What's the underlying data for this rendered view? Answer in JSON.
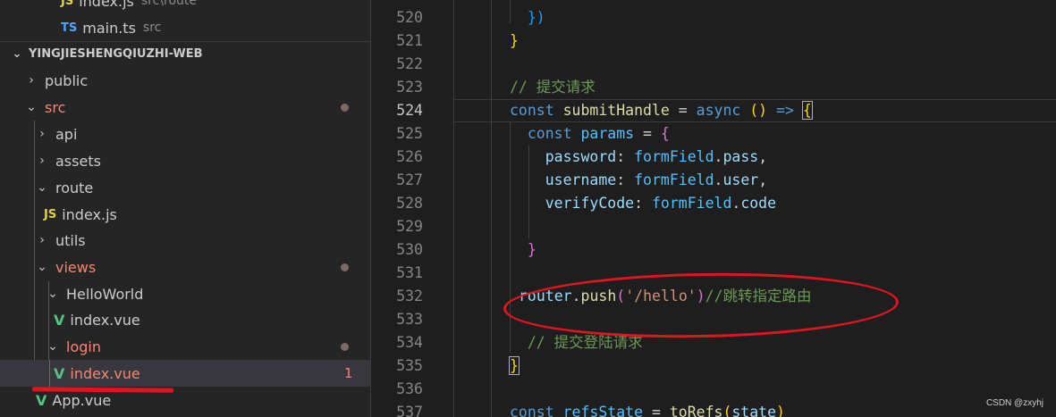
{
  "explorer": {
    "top_partial": {
      "label": "index.js",
      "suffix": "src\\route"
    },
    "open_file": {
      "label": "main.ts",
      "suffix": "src",
      "icon": "TS"
    },
    "project_name": "YINGJIESHENGQIUZHI-WEB",
    "items": [
      {
        "label": "public",
        "chev": "›"
      },
      {
        "label": "src",
        "chev": "⌄"
      },
      {
        "label": "api",
        "chev": "›"
      },
      {
        "label": "assets",
        "chev": "›"
      },
      {
        "label": "route",
        "chev": "⌄"
      },
      {
        "label": "index.js",
        "icon": "JS"
      },
      {
        "label": "utils",
        "chev": "›"
      },
      {
        "label": "views",
        "chev": "⌄"
      },
      {
        "label": "HelloWorld",
        "chev": "⌄"
      },
      {
        "label": "index.vue",
        "icon": "V"
      },
      {
        "label": "login",
        "chev": "⌄"
      },
      {
        "label": "index.vue",
        "icon": "V",
        "badge": "1"
      },
      {
        "label": "App.vue",
        "icon": "V"
      }
    ]
  },
  "editor": {
    "line_numbers": [
      "520",
      "521",
      "522",
      "523",
      "524",
      "525",
      "526",
      "527",
      "528",
      "529",
      "530",
      "531",
      "532",
      "533",
      "534",
      "535",
      "536",
      "537"
    ],
    "active_line": "524",
    "tokens": {
      "l520": "})",
      "l521": "}",
      "l523": "// 提交请求",
      "l524_const": "const",
      "l524_name": "submitHandle",
      "l524_eq": " = ",
      "l524_async": "async",
      "l524_paren": "()",
      "l524_arrow": " => ",
      "l524_brace": "{",
      "l525_const": "const",
      "l525_name": "params",
      "l525_eq": " = ",
      "l525_brace": "{",
      "l526_key": "password",
      "l526_obj": "formField",
      "l526_prop": "pass",
      "l527_key": "username",
      "l527_obj": "formField",
      "l527_prop": "user",
      "l528_key": "verifyCode",
      "l528_obj": "formField",
      "l528_prop": "code",
      "l530": "}",
      "l532_router": "router",
      "l532_push": "push",
      "l532_str": "'/hello'",
      "l532_comment": "//跳转指定路由",
      "l534": "// 提交登陆请求",
      "l535": "}",
      "l537_const": "const",
      "l537_name": "refsState",
      "l537_fn": "toRefs",
      "l537_arg": "state"
    }
  },
  "watermark": "CSDN @zxyhj",
  "colors": {
    "annotation": "#e0151f",
    "modified": "#f48771"
  }
}
